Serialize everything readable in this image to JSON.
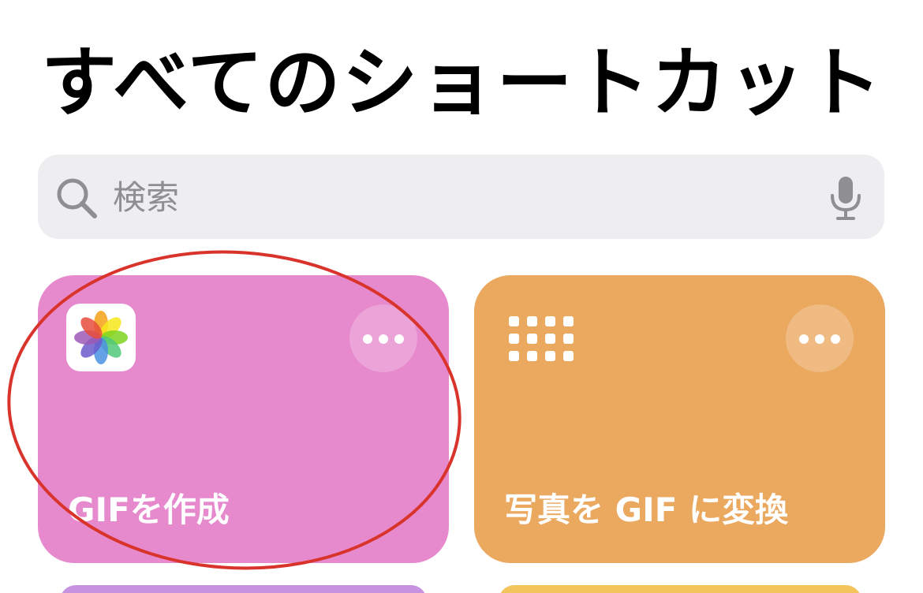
{
  "header": {
    "title": "すべてのショートカット"
  },
  "search": {
    "placeholder": "検索",
    "search_icon": "magnifying-glass-icon",
    "mic_icon": "microphone-icon"
  },
  "shortcuts": [
    {
      "label": "GIFを作成",
      "color": "#e68acd",
      "icon": "photos-app-icon",
      "more_icon": "ellipsis-icon"
    },
    {
      "label": "写真を GIF に変換",
      "color": "#eba85f",
      "icon": "grid-icon",
      "more_icon": "ellipsis-icon"
    }
  ],
  "partial_cards": [
    {
      "color": "#c792df"
    },
    {
      "color": "#f2c45c"
    }
  ],
  "annotation": {
    "shape": "ellipse",
    "color": "#d9342b"
  }
}
